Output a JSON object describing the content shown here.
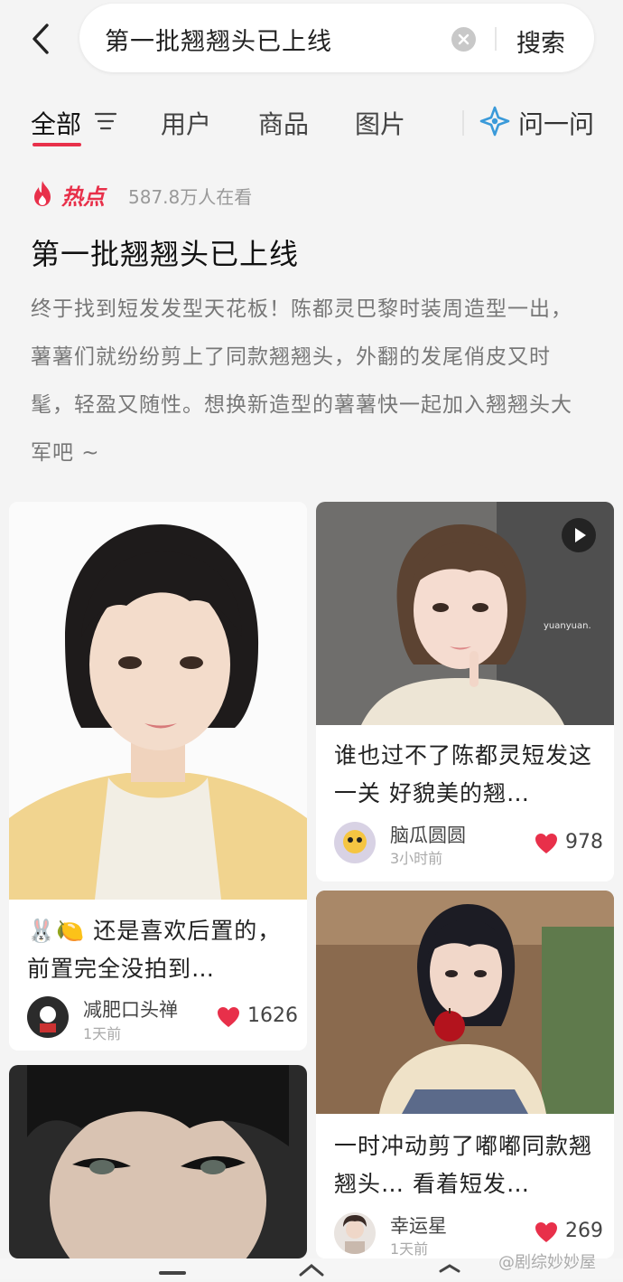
{
  "search": {
    "query": "第一批翘翘头已上线",
    "button_label": "搜索"
  },
  "tabs": {
    "items": [
      "全部",
      "用户",
      "商品",
      "图片"
    ],
    "ask_label": "问一问"
  },
  "hot": {
    "label": "热点",
    "views": "587.8万人在看",
    "title": "第一批翘翘头已上线",
    "description": "终于找到短发发型天花板！陈都灵巴黎时装周造型一出，薯薯们就纷纷剪上了同款翘翘头，外翻的发尾俏皮又时髦，轻盈又随性。想换新造型的薯薯快一起加入翘翘头大军吧 ~"
  },
  "cards": [
    {
      "title": "🐰🍋 还是喜欢后置的，前置完全没拍到…",
      "author": "减肥口头禅",
      "time": "1天前",
      "likes": "1626"
    },
    {
      "title": "谁也过不了陈都灵短发这一关 好貌美的翘…",
      "author": "脑瓜圆圆",
      "time": "3小时前",
      "likes": "978",
      "image_caption": "yuanyuan."
    },
    {
      "title": "一时冲动剪了嘟嘟同款翘翘头… 看着短发…",
      "author": "幸运星",
      "time": "1天前",
      "likes": "269"
    }
  ],
  "watermark": "@剧综妙妙屋",
  "colors": {
    "accent": "#e8304a",
    "text": "#222222",
    "muted": "#999999"
  },
  "icons": {
    "back": "chevron-left-icon",
    "clear": "clear-icon",
    "filter": "filter-icon",
    "ask": "star-sparkle-icon",
    "hot": "flame-icon",
    "like": "heart-icon",
    "play": "play-icon"
  }
}
